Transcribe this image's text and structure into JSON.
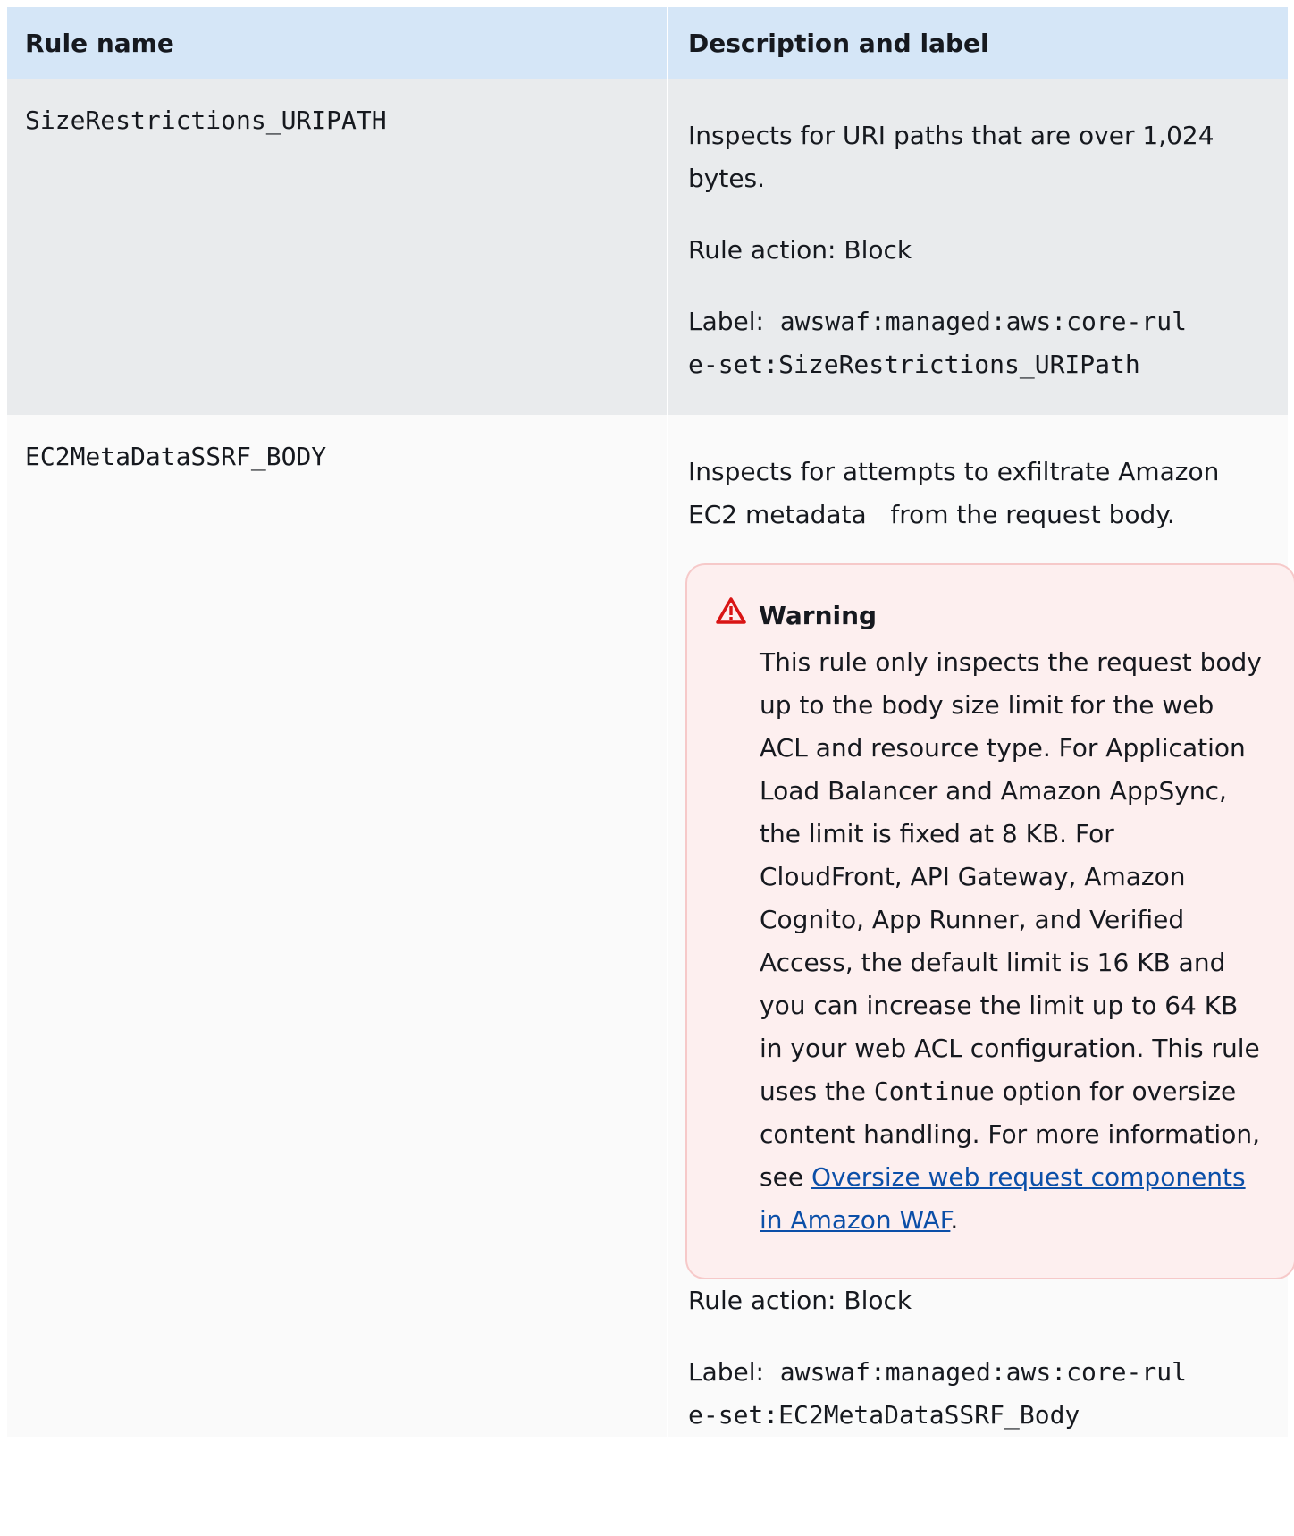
{
  "table": {
    "headers": [
      "Rule name",
      "Description and label"
    ],
    "rows": [
      {
        "rule_name": "SizeRestrictions_URIPATH",
        "description": "Inspects for URI paths that are over 1,024 bytes.",
        "rule_action": "Rule action: Block",
        "label_prefix": "Label:",
        "label_line1": "awswaf:managed:aws:core-rul",
        "label_line2": "e-set:SizeRestrictions_URIPath"
      },
      {
        "rule_name": "EC2MetaDataSSRF_BODY",
        "description": "Inspects for attempts to exfiltrate Amazon EC2 metadata   from the request body.",
        "warning": {
          "icon": "warning-triangle-icon",
          "title": "Warning",
          "body_pre": "This rule only inspects the request body up to the body size limit for the web ACL and resource type. For Application Load Balancer and Amazon AppSync, the limit is fixed at 8 KB. For CloudFront, API Gateway, Amazon Cognito, App Runner, and Verified Access, the default limit is 16 KB and you can increase the limit up to 64 KB in your web ACL configuration. This rule uses the ",
          "body_code": "Continue",
          "body_mid": " option for oversize content handling. For more information, see ",
          "link_text": "Oversize web request components in Amazon WAF",
          "body_post": "."
        },
        "rule_action": "Rule action: Block",
        "label_prefix": "Label:",
        "label_line1": "awswaf:managed:aws:core-rul",
        "label_line2": "e-set:EC2MetaDataSSRF_Body"
      }
    ]
  },
  "colors": {
    "header_bg": "#d5e6f7",
    "row1_bg": "#e9ebed",
    "row2_bg": "#fafafa",
    "warning_bg": "#fdefef",
    "warning_border": "#f6c9c9",
    "warning_icon": "#d91515",
    "link": "#0b4fa8"
  }
}
